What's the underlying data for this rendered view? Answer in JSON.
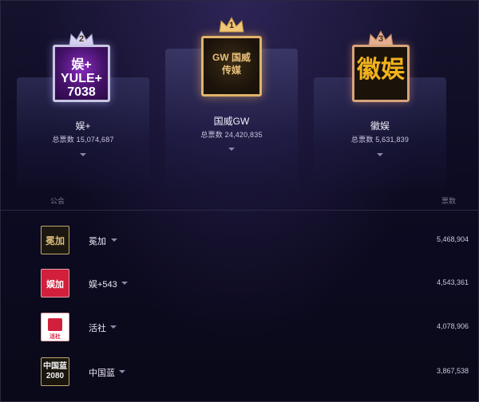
{
  "podium": [
    {
      "rank": "2",
      "name": "娱+",
      "votes": "总票数 15,074,687",
      "logo_text": "娱+ YULE+ 7038"
    },
    {
      "rank": "1",
      "name": "国威GW",
      "votes": "总票数 24,420,835",
      "logo_text": "GW 国威传媒"
    },
    {
      "rank": "3",
      "name": "徽娱",
      "votes": "总票数 5,631,839",
      "logo_text": "徽娱"
    }
  ],
  "table": {
    "col_union": "公会",
    "col_votes": "票数",
    "rows": [
      {
        "name": "冕加",
        "votes": "5,468,904",
        "logo_text": "冕加"
      },
      {
        "name": "娱+543",
        "votes": "4,543,361",
        "logo_text": "娱加"
      },
      {
        "name": "活社",
        "votes": "4,078,906",
        "logo_text": "活社"
      },
      {
        "name": "中国蓝",
        "votes": "3,867,538",
        "logo_text": "中国蓝 2080"
      }
    ]
  },
  "colors": {
    "background": "#0b0a1c",
    "gold": "#e0b36a",
    "silver": "#c9c6e4",
    "bronze": "#d7a37c",
    "accent_red": "#d21f3c"
  },
  "icons": [
    "crown-icon",
    "chevron-down-icon"
  ]
}
